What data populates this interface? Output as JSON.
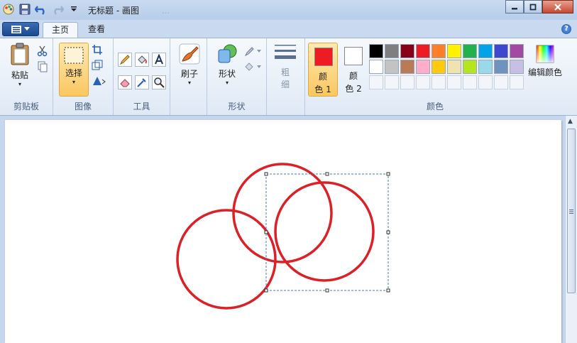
{
  "title_bar": {
    "document_title": "无标题 - 画图",
    "blurred_text": "...",
    "qat_icons": [
      "paint-app-icon",
      "save-icon",
      "undo-icon",
      "redo-icon",
      "qat-dropdown-icon"
    ]
  },
  "tabs": [
    {
      "label": "主页",
      "active": true
    },
    {
      "label": "查看",
      "active": false
    }
  ],
  "ribbon": {
    "clipboard": {
      "paste_label": "粘贴",
      "group_label": "剪贴板"
    },
    "image": {
      "select_label": "选择",
      "group_label": "图像"
    },
    "tools": {
      "group_label": "工具"
    },
    "brushes": {
      "label": "刷子"
    },
    "shapes": {
      "label": "形状",
      "group_label": "形状"
    },
    "size": {
      "label_line1": "粗",
      "label_line2": "细"
    },
    "colors": {
      "color1_line1": "颜",
      "color1_line2": "色 1",
      "color2_line1": "颜",
      "color2_line2": "色 2",
      "edit_colors_label": "编辑颜色",
      "group_label": "颜色",
      "color1_value": "#ed1c24",
      "color2_value": "#ffffff",
      "palette": [
        "#000000",
        "#7f7f7f",
        "#880015",
        "#ed1c24",
        "#ff7f27",
        "#fff200",
        "#22b14c",
        "#00a2e8",
        "#3f48cc",
        "#a349a4",
        "#ffffff",
        "#c3c3c3",
        "#b97a57",
        "#ffaec9",
        "#ffc90e",
        "#efe4b0",
        "#b5e61d",
        "#99d9ea",
        "#7092be",
        "#c8bfe7"
      ]
    }
  },
  "canvas": {
    "stroke_color": "#dd1f26",
    "circle_count": 3
  }
}
